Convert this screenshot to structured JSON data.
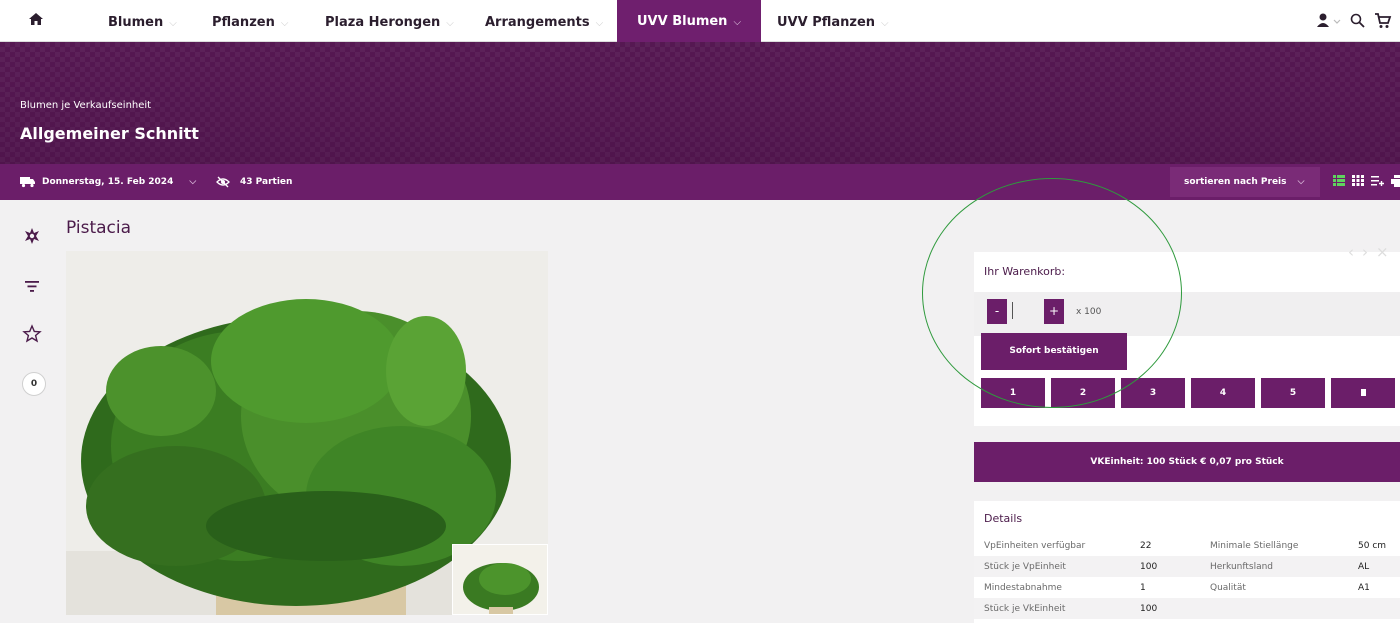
{
  "nav": {
    "items": [
      {
        "label": "Blumen"
      },
      {
        "label": "Pflanzen"
      },
      {
        "label": "Plaza Herongen"
      },
      {
        "label": "Arrangements"
      },
      {
        "label": "UVV Blumen"
      },
      {
        "label": "UVV Pflanzen"
      }
    ],
    "active": "UVV Blumen"
  },
  "banner": {
    "subtitle": "Blumen je Verkaufseinheit",
    "title": "Allgemeiner Schnitt"
  },
  "filter": {
    "date": "Donnerstag, 15. Feb 2024",
    "lots": "43 Partien",
    "sort": "sortieren nach Preis"
  },
  "sidebar": {
    "cart_count": "0"
  },
  "product": {
    "name": "Pistacia"
  },
  "cart": {
    "label": "Ihr Warenkorb:",
    "minus": "-",
    "plus": "+",
    "quantity_value": "",
    "multiplier": "x  100",
    "confirm_label": "Sofort bestätigen",
    "quick": [
      "1",
      "2",
      "3",
      "4",
      "5"
    ]
  },
  "vk_unit": "VKEinheit: 100 Stück € 0,07 pro Stück",
  "details": {
    "heading": "Details",
    "rows": [
      {
        "label": "VpEinheiten verfügbar",
        "value": "22",
        "label2": "Minimale Stiellänge",
        "value2": "50 cm"
      },
      {
        "label": "Stück je VpEinheit",
        "value": "100",
        "label2": "Herkunftsland",
        "value2": "AL"
      },
      {
        "label": "Mindestabnahme",
        "value": "1",
        "label2": "Qualität",
        "value2": "A1"
      },
      {
        "label": "Stück je VkEinheit",
        "value": "100",
        "label2": "",
        "value2": ""
      }
    ]
  },
  "colors": {
    "brand": "#6b1e69",
    "banner": "#5a1a56",
    "annotation_ring": "#2f9a3d"
  },
  "icons": [
    "home-icon",
    "user-icon",
    "search-icon",
    "cart-icon",
    "truck-icon",
    "eye-off-icon",
    "list-view-icon",
    "grid-view-icon",
    "compact-view-icon",
    "print-icon",
    "flower-icon",
    "filter-icon",
    "star-icon",
    "trash-icon"
  ]
}
